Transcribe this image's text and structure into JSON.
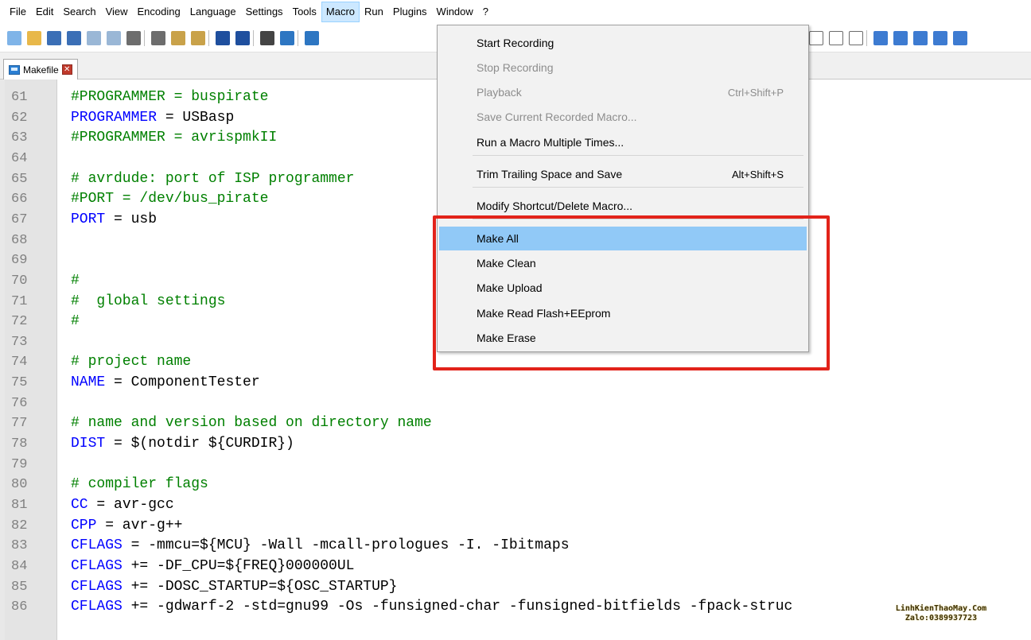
{
  "menubar": {
    "items": [
      "File",
      "Edit",
      "Search",
      "View",
      "Encoding",
      "Language",
      "Settings",
      "Tools",
      "Macro",
      "Run",
      "Plugins",
      "Window",
      "?"
    ],
    "active": "Macro"
  },
  "tab": {
    "label": "Makefile",
    "close_glyph": "✕"
  },
  "macro_menu": {
    "items": [
      {
        "label": "Start Recording",
        "shortcut": "",
        "enabled": true
      },
      {
        "label": "Stop Recording",
        "shortcut": "",
        "enabled": false
      },
      {
        "label": "Playback",
        "shortcut": "Ctrl+Shift+P",
        "enabled": false
      },
      {
        "label": "Save Current Recorded Macro...",
        "shortcut": "",
        "enabled": false
      },
      {
        "label": "Run a Macro Multiple Times...",
        "shortcut": "",
        "enabled": true
      },
      {
        "label": "Trim Trailing Space and Save",
        "shortcut": "Alt+Shift+S",
        "enabled": true
      },
      {
        "label": "Modify Shortcut/Delete Macro...",
        "shortcut": "",
        "enabled": true
      },
      {
        "label": "Make All",
        "shortcut": "",
        "enabled": true,
        "highlighted": true
      },
      {
        "label": "Make Clean",
        "shortcut": "",
        "enabled": true
      },
      {
        "label": "Make Upload",
        "shortcut": "",
        "enabled": true
      },
      {
        "label": "Make Read Flash+EEprom",
        "shortcut": "",
        "enabled": true
      },
      {
        "label": "Make Erase",
        "shortcut": "",
        "enabled": true
      }
    ]
  },
  "editor": {
    "lines": [
      {
        "num": "61",
        "text": "#PROGRAMMER = buspirate",
        "kind": "comment"
      },
      {
        "num": "62",
        "var": "PROGRAMMER",
        "rest": " = USBasp",
        "kind": "assign"
      },
      {
        "num": "63",
        "text": "#PROGRAMMER = avrispmkII",
        "kind": "comment"
      },
      {
        "num": "64",
        "text": "",
        "kind": "blank"
      },
      {
        "num": "65",
        "text": "# avrdude: port of ISP programmer",
        "kind": "comment"
      },
      {
        "num": "66",
        "text": "#PORT = /dev/bus_pirate",
        "kind": "comment"
      },
      {
        "num": "67",
        "var": "PORT",
        "rest": " = usb",
        "kind": "assign"
      },
      {
        "num": "68",
        "text": "",
        "kind": "blank"
      },
      {
        "num": "69",
        "text": "",
        "kind": "blank"
      },
      {
        "num": "70",
        "text": "#",
        "kind": "comment"
      },
      {
        "num": "71",
        "text": "#  global settings",
        "kind": "comment"
      },
      {
        "num": "72",
        "text": "#",
        "kind": "comment"
      },
      {
        "num": "73",
        "text": "",
        "kind": "blank"
      },
      {
        "num": "74",
        "text": "# project name",
        "kind": "comment"
      },
      {
        "num": "75",
        "var": "NAME",
        "rest": " = ComponentTester",
        "kind": "assign"
      },
      {
        "num": "76",
        "text": "",
        "kind": "blank"
      },
      {
        "num": "77",
        "text": "# name and version based on directory name",
        "kind": "comment"
      },
      {
        "num": "78",
        "var": "DIST",
        "rest": " = $(notdir ${CURDIR})",
        "kind": "assign"
      },
      {
        "num": "79",
        "text": "",
        "kind": "blank"
      },
      {
        "num": "80",
        "text": "# compiler flags",
        "kind": "comment"
      },
      {
        "num": "81",
        "var": "CC",
        "rest": " = avr-gcc",
        "kind": "assign"
      },
      {
        "num": "82",
        "var": "CPP",
        "rest": " = avr-g++",
        "kind": "assign"
      },
      {
        "num": "83",
        "var": "CFLAGS",
        "rest": " = -mmcu=${MCU} -Wall -mcall-prologues -I. -Ibitmaps",
        "kind": "assign"
      },
      {
        "num": "84",
        "var": "CFLAGS",
        "rest": " += -DF_CPU=${FREQ}000000UL",
        "kind": "assign"
      },
      {
        "num": "85",
        "var": "CFLAGS",
        "rest": " += -DOSC_STARTUP=${OSC_STARTUP}",
        "kind": "assign"
      },
      {
        "num": "86",
        "var": "CFLAGS",
        "rest": " += -gdwarf-2 -std=gnu99 -Os -funsigned-char -funsigned-bitfields -fpack-struc",
        "kind": "assign"
      }
    ]
  },
  "watermark": {
    "line1": "LinhKienThaoMay.Com",
    "line2": "Zalo:0389937723"
  },
  "colors": {
    "comment": "#008000",
    "variable": "#0000ff",
    "highlight": "#91c9f7",
    "annotation_box": "#e2231a"
  }
}
